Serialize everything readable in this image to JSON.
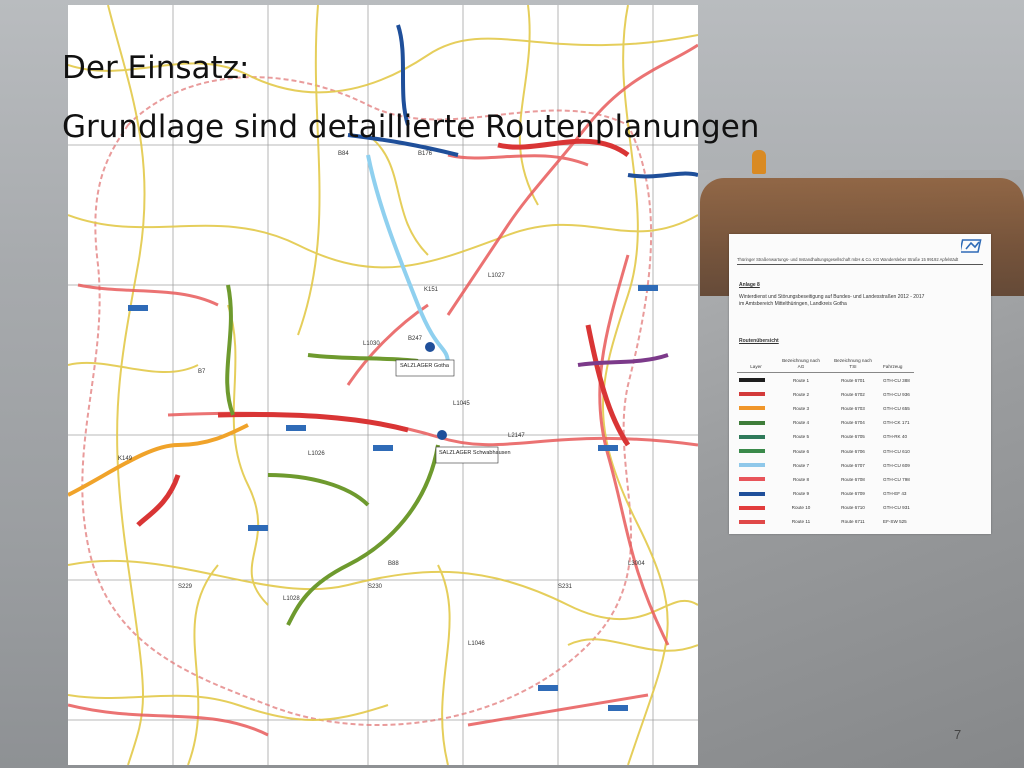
{
  "slide": {
    "title_line1": "Der Einsatz:",
    "title_line2": "Grundlage sind detaillierte Routenplanungen",
    "page_number": "7"
  },
  "map": {
    "place_labels": [
      "SALZLAGER Gotha",
      "SALZLAGER Schwabhausen"
    ],
    "road_labels": [
      "B247",
      "B88",
      "B84",
      "B7",
      "B176",
      "L1026",
      "L1027",
      "L1028",
      "L1030",
      "L1045",
      "L1046",
      "L2147",
      "L3004",
      "S229",
      "S230",
      "S231",
      "K149",
      "K151"
    ]
  },
  "document": {
    "header": "Thüringer Straßenwartungs- und Instandhaltungsgesellschaft mbH & Co. KG    Wandersleber Straße 15    99192 Apfelstädt",
    "heading": "Anlage 8",
    "subtitle_line1": "Winterdienst und Störungsbeseitigung auf Bundes- und Landesstraßen 2012 - 2017",
    "subtitle_line2": "im Amtsbereich Mittelthüringen, Landkreis Gotha",
    "overview": "Routenübersicht",
    "columns": [
      "Layer",
      "Bezeichnung nach AG",
      "Bezeichnung nach TSI",
      "Fahrzeug"
    ],
    "rows": [
      {
        "ag": "Route 1",
        "tsi": "Route 6701",
        "fz": "GTH-CU 388",
        "color": "#1e1e1e"
      },
      {
        "ag": "Route 2",
        "tsi": "Route 6702",
        "fz": "GTH-CU 936",
        "color": "#d33a3a"
      },
      {
        "ag": "Route 3",
        "tsi": "Route 6703",
        "fz": "GTH-CU 655",
        "color": "#f0962a"
      },
      {
        "ag": "Route 4",
        "tsi": "Route 6704",
        "fz": "GTH-CK 171",
        "color": "#3f7d3a"
      },
      {
        "ag": "Route 5",
        "tsi": "Route 6705",
        "fz": "GTH-RK 40",
        "color": "#2f7a5a"
      },
      {
        "ag": "Route 6",
        "tsi": "Route 6706",
        "fz": "GTH-CU 610",
        "color": "#3a8a4a"
      },
      {
        "ag": "Route 7",
        "tsi": "Route 6707",
        "fz": "GTH-CU 609",
        "color": "#8fc8ea"
      },
      {
        "ag": "Route 8",
        "tsi": "Route 6708",
        "fz": "GTH-CU 798",
        "color": "#e8545a"
      },
      {
        "ag": "Route 9",
        "tsi": "Route 6709",
        "fz": "GTH-EF 43",
        "color": "#1f4f9a"
      },
      {
        "ag": "Route 10",
        "tsi": "Route 6710",
        "fz": "GTH-CU 931",
        "color": "#e23c3c"
      },
      {
        "ag": "Route 11",
        "tsi": "Route 6711",
        "fz": "EF-SW 525",
        "color": "#e04848"
      }
    ]
  }
}
